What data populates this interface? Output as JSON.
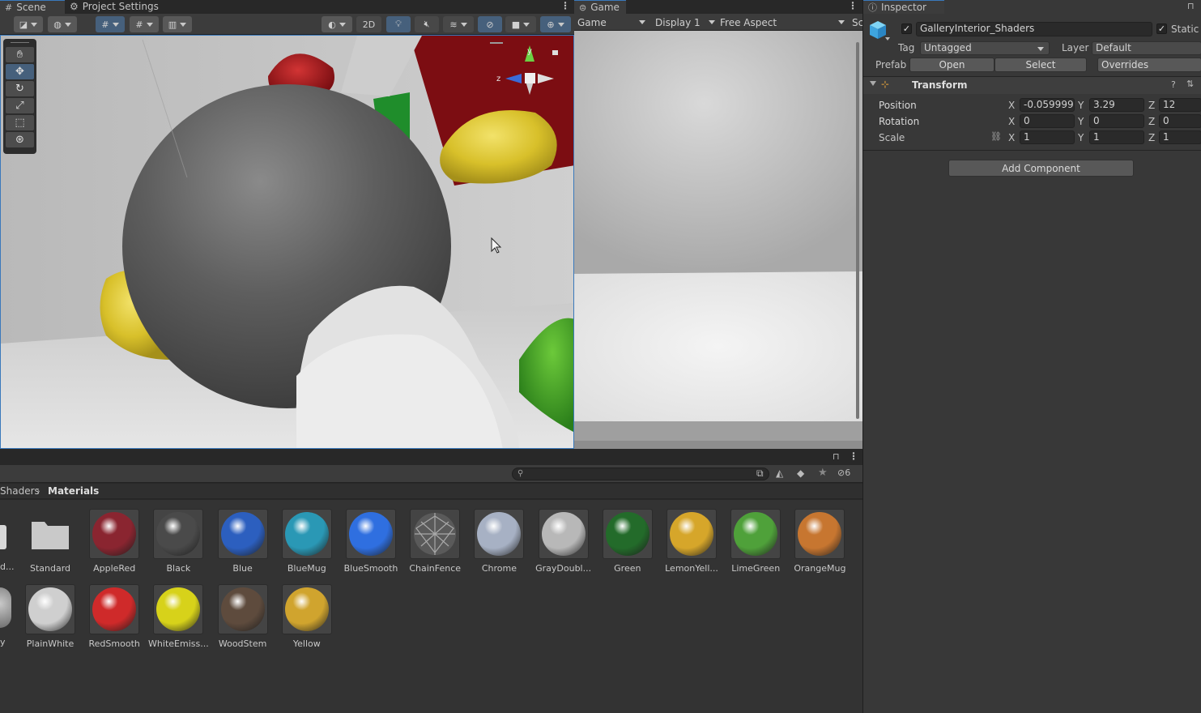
{
  "scene_tabs": {
    "scene": "Scene",
    "project_settings": "Project Settings"
  },
  "scene_toolbar": {
    "two_d": "2D"
  },
  "game_tab": "Game",
  "game_toolbar": {
    "mode": "Game",
    "display": "Display 1",
    "aspect": "Free Aspect",
    "scale_label": "Sc"
  },
  "inspector": {
    "tab": "Inspector",
    "object_name": "GalleryInterior_Shaders",
    "static_label": "Static",
    "tag_label": "Tag",
    "tag_value": "Untagged",
    "layer_label": "Layer",
    "layer_value": "Default",
    "prefab_label": "Prefab",
    "prefab_open": "Open",
    "prefab_select": "Select",
    "prefab_overrides": "Overrides",
    "transform_title": "Transform",
    "position_label": "Position",
    "rotation_label": "Rotation",
    "scale_label": "Scale",
    "axis_x": "X",
    "axis_y": "Y",
    "axis_z": "Z",
    "position": {
      "x": "-0.059999",
      "y": "3.29",
      "z": "12"
    },
    "rotation": {
      "x": "0",
      "y": "0",
      "z": "0"
    },
    "scale": {
      "x": "1",
      "y": "1",
      "z": "1"
    },
    "add_component": "Add Component"
  },
  "project": {
    "hidden_count": "6",
    "breadcrumb_parent": "Shaders",
    "breadcrumb_current": "Materials",
    "row1": [
      {
        "name": "Standard",
        "kind": "folder"
      },
      {
        "name": "AppleRed",
        "color": "#8a2530"
      },
      {
        "name": "Black",
        "color": "#4a4a4a"
      },
      {
        "name": "Blue",
        "color": "#2c5fbf"
      },
      {
        "name": "BlueMug",
        "color": "#2a98b5"
      },
      {
        "name": "BlueSmooth",
        "color": "#2f6fe0"
      },
      {
        "name": "ChainFence",
        "kind": "fence"
      },
      {
        "name": "Chrome",
        "color": "#a7b1c4"
      },
      {
        "name": "GrayDoubl...",
        "color": "#b8b8b8"
      },
      {
        "name": "Green",
        "color": "#236b2a"
      },
      {
        "name": "LemonYell...",
        "color": "#d6a62a"
      },
      {
        "name": "LimeGreen",
        "color": "#4fa13a"
      },
      {
        "name": "OrangeMug",
        "color": "#c77630"
      }
    ],
    "row2": [
      {
        "name": "PlainWhite",
        "color": "#cfcfcf"
      },
      {
        "name": "RedSmooth",
        "color": "#cf2a2a"
      },
      {
        "name": "WhiteEmiss...",
        "color": "#d7d21a"
      },
      {
        "name": "WoodStem",
        "color": "#5e4b3d"
      },
      {
        "name": "Yellow",
        "color": "#d0a42e"
      }
    ],
    "partial_left_row1": "d...",
    "partial_left_row2": "y"
  }
}
